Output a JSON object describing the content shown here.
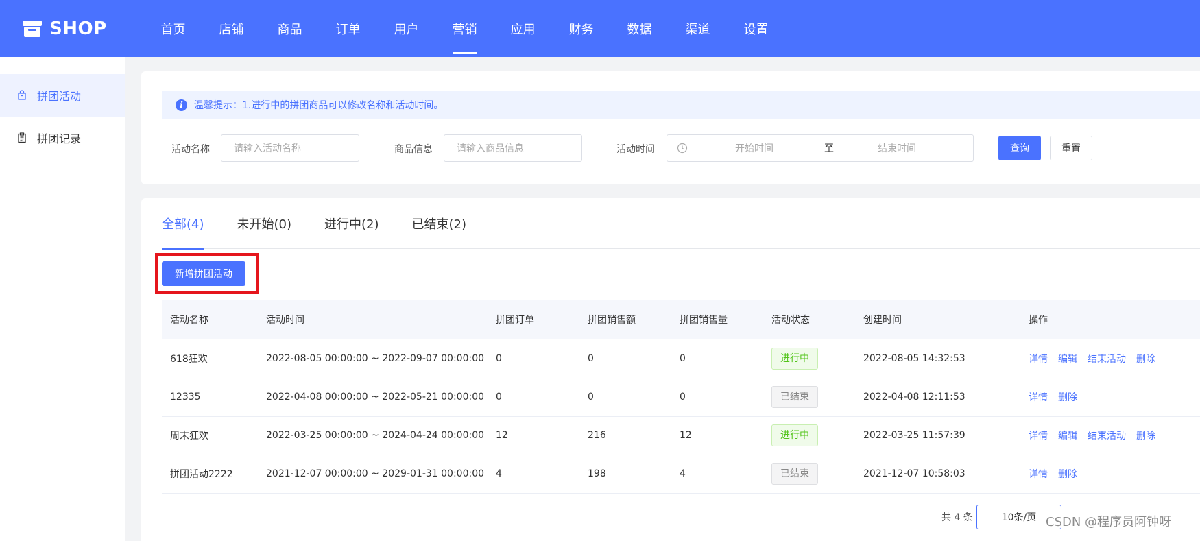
{
  "colors": {
    "brand": "#4a72ff",
    "red_highlight": "#e5161d",
    "success": "#52c41a"
  },
  "logo": {
    "text": "SHOP",
    "icon": "store-icon"
  },
  "nav": {
    "items": [
      "首页",
      "店铺",
      "商品",
      "订单",
      "用户",
      "营销",
      "应用",
      "财务",
      "数据",
      "渠道",
      "设置"
    ],
    "active": "营销"
  },
  "sidebar": {
    "items": [
      {
        "label": "拼团活动",
        "icon": "bag-icon",
        "active": true
      },
      {
        "label": "拼团记录",
        "icon": "clipboard-icon",
        "active": false
      }
    ]
  },
  "notice": {
    "text": "温馨提示：1.进行中的拼团商品可以修改名称和活动时间。",
    "icon": "info-icon"
  },
  "filters": {
    "activity_name_label": "活动名称",
    "activity_name_placeholder": "请输入活动名称",
    "product_label": "商品信息",
    "product_placeholder": "请输入商品信息",
    "time_label": "活动时间",
    "time_start_placeholder": "开始时间",
    "time_separator": "至",
    "time_end_placeholder": "结束时间",
    "query_label": "查询",
    "reset_label": "重置"
  },
  "tabs": [
    {
      "label": "全部(4)",
      "active": true
    },
    {
      "label": "未开始(0)",
      "active": false
    },
    {
      "label": "进行中(2)",
      "active": false
    },
    {
      "label": "已结束(2)",
      "active": false
    }
  ],
  "add_button": "新增拼团活动",
  "table": {
    "headers": [
      "活动名称",
      "活动时间",
      "拼团订单",
      "拼团销售额",
      "拼团销售量",
      "活动状态",
      "创建时间",
      "操作"
    ],
    "rows": [
      {
        "name": "618狂欢",
        "time": "2022-08-05 00:00:00 ~ 2022-09-07 00:00:00",
        "orders": "0",
        "sales": "0",
        "qty": "0",
        "status": "进行中",
        "status_type": "running",
        "created": "2022-08-05 14:32:53",
        "actions": [
          "详情",
          "编辑",
          "结束活动",
          "删除"
        ]
      },
      {
        "name": "12335",
        "time": "2022-04-08 00:00:00 ~ 2022-05-21 00:00:00",
        "orders": "0",
        "sales": "0",
        "qty": "0",
        "status": "已结束",
        "status_type": "ended",
        "created": "2022-04-08 12:11:53",
        "actions": [
          "详情",
          "删除"
        ]
      },
      {
        "name": "周末狂欢",
        "time": "2022-03-25 00:00:00 ~ 2024-04-24 00:00:00",
        "orders": "12",
        "sales": "216",
        "qty": "12",
        "status": "进行中",
        "status_type": "running",
        "created": "2022-03-25 11:57:39",
        "actions": [
          "详情",
          "编辑",
          "结束活动",
          "删除"
        ]
      },
      {
        "name": "拼团活动2222",
        "time": "2021-12-07 00:00:00 ~ 2029-01-31 00:00:00",
        "orders": "4",
        "sales": "198",
        "qty": "4",
        "status": "已结束",
        "status_type": "ended",
        "created": "2021-12-07 10:58:03",
        "actions": [
          "详情",
          "删除"
        ]
      }
    ]
  },
  "pagination": {
    "total": "共 4 条",
    "page_size": "10条/页"
  },
  "watermark": "CSDN @程序员阿钟呀"
}
